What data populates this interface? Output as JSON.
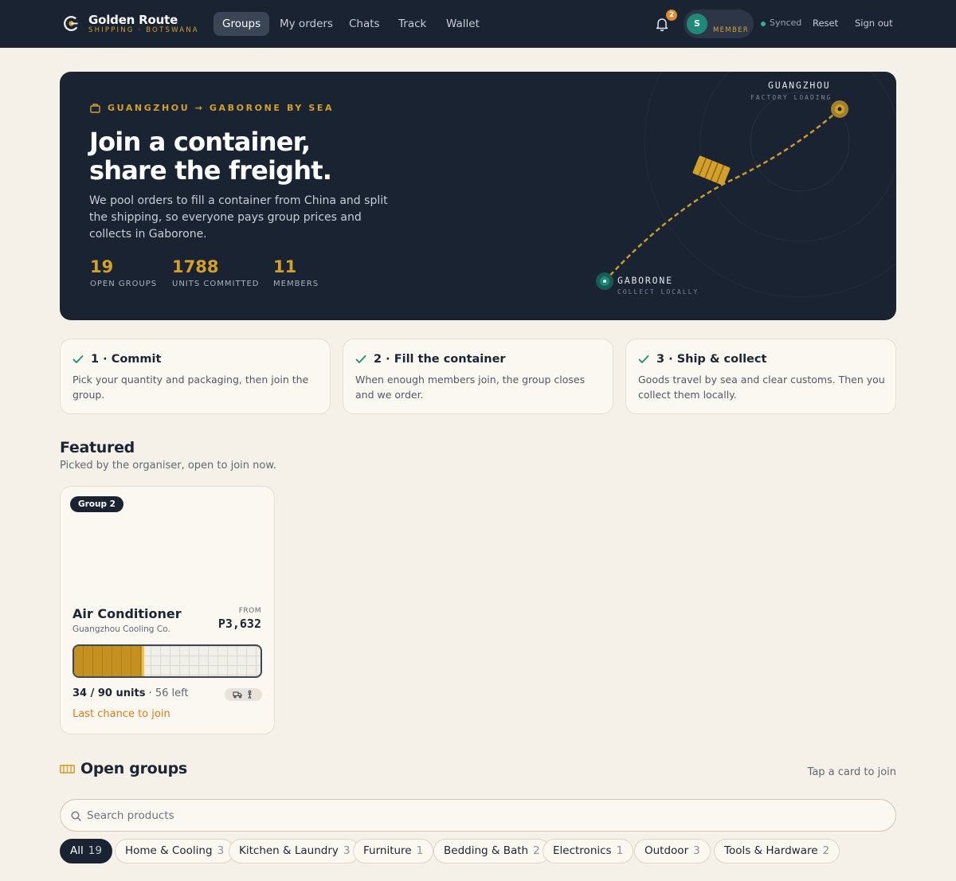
{
  "topbar": {
    "brand_name": "Golden Route",
    "brand_sub": "SHIPPING · BOTSWANA",
    "nav": [
      {
        "label": "Groups",
        "active": true
      },
      {
        "label": "My orders"
      },
      {
        "label": "Chats"
      },
      {
        "label": "Track"
      },
      {
        "label": "Wallet"
      }
    ],
    "notification_count": "2",
    "avatar_initial": "S",
    "member_label": "MEMBER",
    "sync_status": "Synced",
    "reset_label": "Reset",
    "signout_label": "Sign out"
  },
  "hero": {
    "kicker": "GUANGZHOU → GABORONE BY SEA",
    "title_line1": "Join a container,",
    "title_line2": "share the freight.",
    "description": "We pool orders to fill a container from China and split the shipping, so everyone pays group prices and collects in Gaborone.",
    "stats": [
      {
        "value": "19",
        "label": "OPEN GROUPS"
      },
      {
        "value": "1788",
        "label": "UNITS COMMITTED"
      },
      {
        "value": "11",
        "label": "MEMBERS"
      }
    ],
    "origin": {
      "name": "GUANGZHOU",
      "sub": "FACTORY LOADING"
    },
    "destination": {
      "name": "GABORONE",
      "sub": "COLLECT LOCALLY"
    }
  },
  "steps": [
    {
      "title": "1 · Commit",
      "desc": "Pick your quantity and packaging, then join the group."
    },
    {
      "title": "2 · Fill the container",
      "desc": "When enough members join, the group closes and we order."
    },
    {
      "title": "3 · Ship & collect",
      "desc": "Goods travel by sea and clear customs. Then you collect them locally."
    }
  ],
  "featured": {
    "title": "Featured",
    "subtitle": "Picked by the organiser, open to join now.",
    "card": {
      "tag": "Group 2",
      "product": "Air Conditioner",
      "vendor": "Guangzhou Cooling Co.",
      "from_label": "FROM",
      "price": "P3,632",
      "units_committed": "34 / 90 units",
      "units_left": "56 left",
      "fill_fraction": 0.378,
      "status": "Last chance to join"
    }
  },
  "open_groups": {
    "title": "Open groups",
    "hint": "Tap a card to join",
    "search_placeholder": "Search products",
    "chips": [
      {
        "label": "All",
        "count": "19"
      },
      {
        "label": "Home & Cooling",
        "count": "3"
      },
      {
        "label": "Kitchen & Laundry",
        "count": "3"
      },
      {
        "label": "Furniture",
        "count": "1"
      },
      {
        "label": "Bedding & Bath",
        "count": "2"
      },
      {
        "label": "Electronics",
        "count": "1"
      },
      {
        "label": "Outdoor",
        "count": "3"
      },
      {
        "label": "Tools & Hardware",
        "count": "2"
      }
    ]
  },
  "colors": {
    "navy": "#1a2332",
    "gold": "#d4a02c",
    "teal": "#1f8a7a",
    "cream": "#f6f1e8",
    "warning": "#e07a1f"
  }
}
